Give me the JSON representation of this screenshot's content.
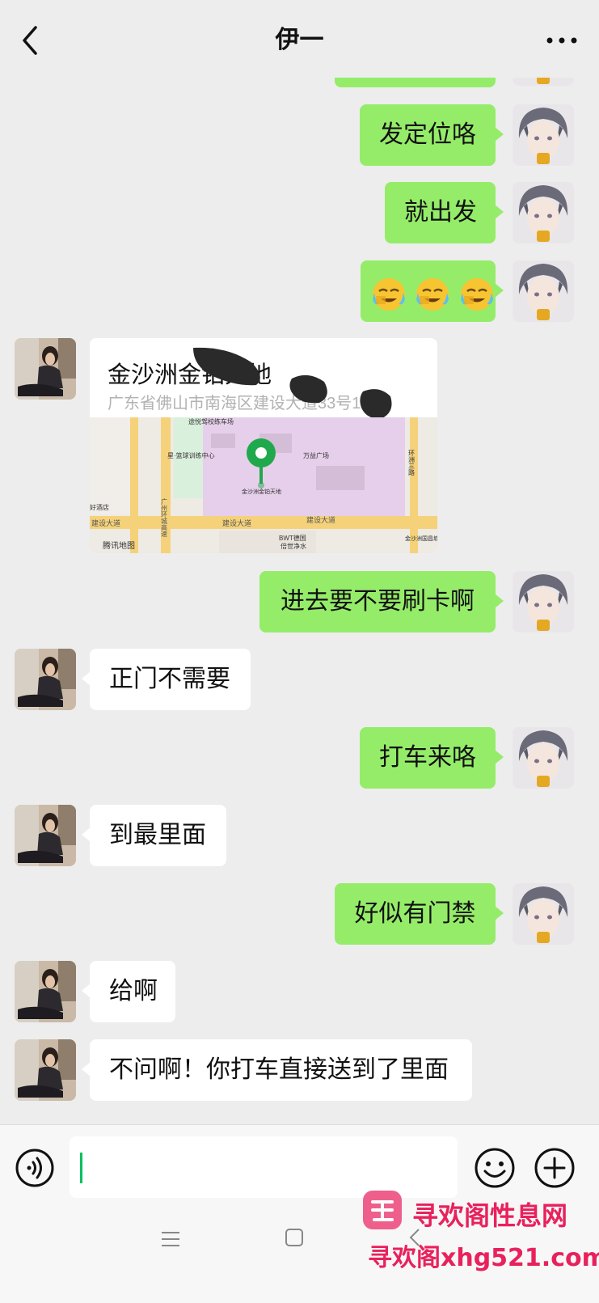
{
  "header": {
    "title": "伊一",
    "back_icon": "chevron-left-icon",
    "more_icon": "more-dots-icon"
  },
  "messages": [
    {
      "from": "me",
      "text": "发定位咯"
    },
    {
      "from": "me",
      "text": "就出发"
    },
    {
      "from": "me",
      "emoji": [
        "face-with-tears-emoji",
        "face-with-tears-emoji",
        "face-with-tears-emoji"
      ]
    },
    {
      "from": "them",
      "type": "location"
    },
    {
      "from": "me",
      "text": "进去要不要刷卡啊"
    },
    {
      "from": "them",
      "text": "正门不需要"
    },
    {
      "from": "me",
      "text": "打车来咯"
    },
    {
      "from": "them",
      "text": "到最里面"
    },
    {
      "from": "me",
      "text": "好似有门禁"
    },
    {
      "from": "them",
      "text": "给啊"
    },
    {
      "from": "them",
      "text": "不问啊！你打车直接送到了里面"
    }
  ],
  "location": {
    "name": "金沙洲金铂天地",
    "address": "广东省佛山市南海区建设大道33号1栋",
    "map_labels": {
      "pin_label": "金沙洲金铂天地",
      "road_1": "建设大道",
      "road_2": "建设大道",
      "road_3": "建设大道",
      "road_4": "广州环城高速",
      "plaza": "万益广场",
      "bwt": "BWT德国",
      "bwt_sub": "倍世净水",
      "training": "途悦驾校练车场",
      "sports": "星·篮球训练中心",
      "hotel": "好酒店",
      "ring_road": "环洲三路",
      "metro_plaza": "金沙洲国昌城市广场",
      "credit": "腾讯地图"
    },
    "redacted_color": "#2a2a2a"
  },
  "input_bar": {
    "placeholder": "",
    "voice_icon": "voice-icon",
    "emoji_icon": "smiley-icon",
    "plus_icon": "plus-icon"
  },
  "nav": {
    "menu_icon": "menu-icon",
    "home_icon": "home-square-icon",
    "back_icon": "nav-back-icon"
  },
  "watermark": {
    "brand": "寻欢阁性息网",
    "url": "寻欢阁xhg521.com"
  },
  "colors": {
    "background": "#ededed",
    "outgoing_bubble": "#95ec69",
    "incoming_bubble": "#ffffff",
    "pin": "#1fa94c",
    "watermark": "#e8215c"
  }
}
